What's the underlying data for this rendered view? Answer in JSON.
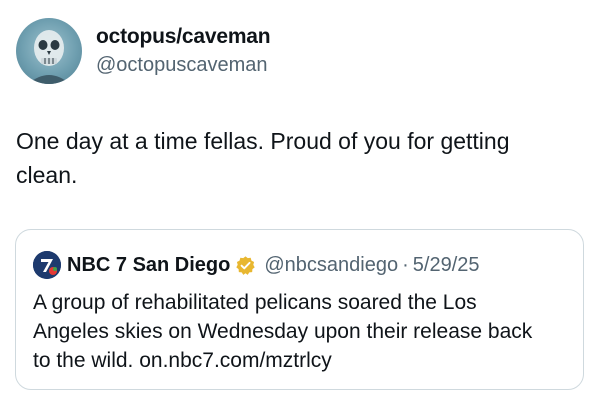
{
  "author": {
    "name": "octopus/caveman",
    "handle": "@octopuscaveman"
  },
  "tweet": {
    "text": "One day at a time fellas. Proud of you for getting clean."
  },
  "quote": {
    "author_name": "NBC 7 San Diego",
    "handle": "@nbcsandiego",
    "separator": "·",
    "date": "5/29/25",
    "text": "A group of rehabilitated pelicans soared the Los Angeles skies on Wednesday upon their release back to the wild. on.nbc7.com/mztrlcy"
  },
  "colors": {
    "text": "#0f1419",
    "secondary_text": "#536471",
    "border": "#cfd9de",
    "verified_badge": "#e8b730"
  },
  "icons": {
    "avatar": "skull-portrait-avatar",
    "quote_logo": "nbc7-logo",
    "verified": "gold-verified-badge-icon"
  }
}
